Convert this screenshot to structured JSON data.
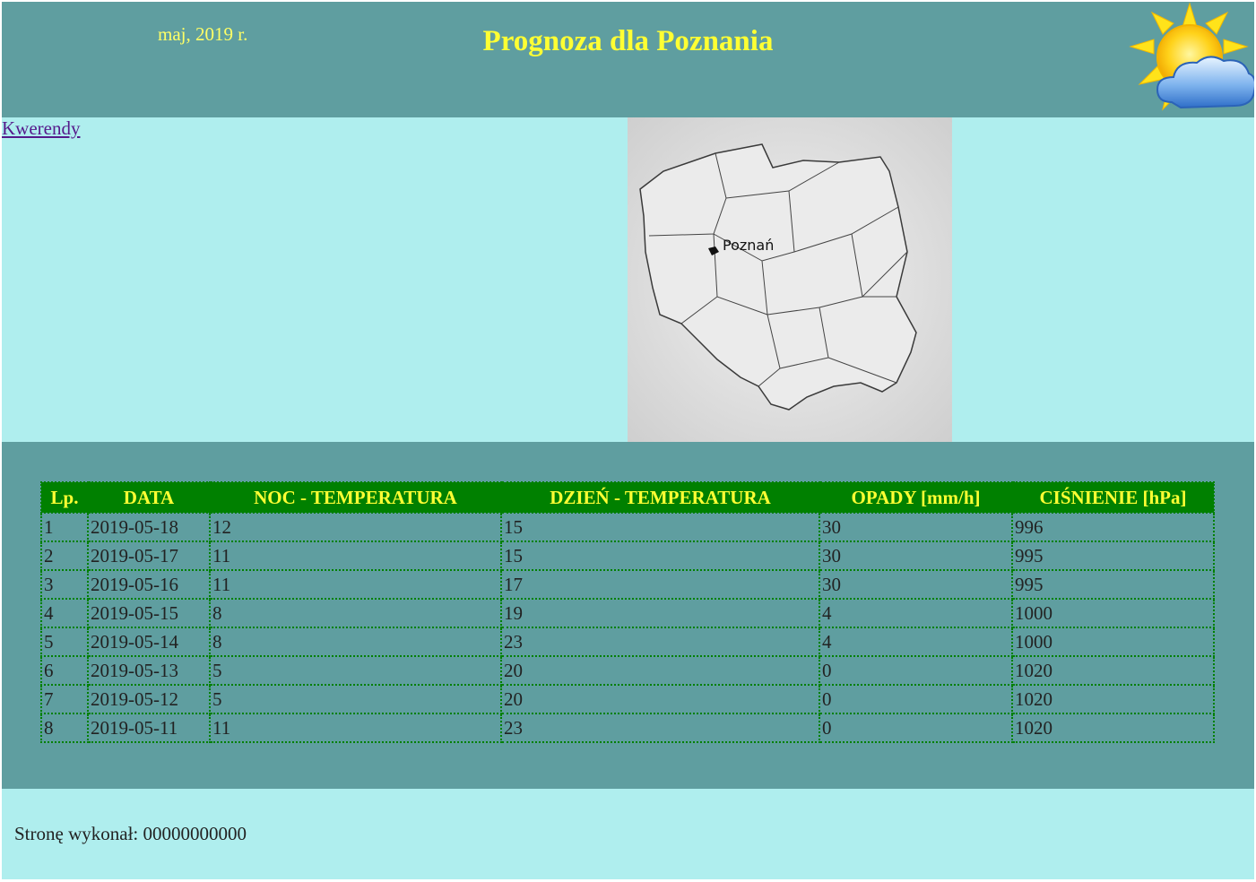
{
  "header": {
    "date": "maj, 2019 r.",
    "title": "Prognoza dla Poznania",
    "sun_icon": "sun-with-cloud-icon"
  },
  "left": {
    "link_label": "Kwerendy"
  },
  "right": {
    "map_label": "Poznań",
    "map_icon": "poland-map-image"
  },
  "table": {
    "headers": [
      "Lp.",
      "DATA",
      "NOC - TEMPERATURA",
      "DZIEŃ - TEMPERATURA",
      "OPADY [mm/h]",
      "CIŚNIENIE [hPa]"
    ],
    "rows": [
      [
        "1",
        "2019-05-18",
        "12",
        "15",
        "30",
        "996"
      ],
      [
        "2",
        "2019-05-17",
        "11",
        "15",
        "30",
        "995"
      ],
      [
        "3",
        "2019-05-16",
        "11",
        "17",
        "30",
        "995"
      ],
      [
        "4",
        "2019-05-15",
        "8",
        "19",
        "4",
        "1000"
      ],
      [
        "5",
        "2019-05-14",
        "8",
        "23",
        "4",
        "1000"
      ],
      [
        "6",
        "2019-05-13",
        "5",
        "20",
        "0",
        "1020"
      ],
      [
        "7",
        "2019-05-12",
        "5",
        "20",
        "0",
        "1020"
      ],
      [
        "8",
        "2019-05-11",
        "11",
        "23",
        "0",
        "1020"
      ]
    ]
  },
  "footer": {
    "text": "Stronę wykonał: 00000000000"
  },
  "colors": {
    "banner": "#5f9ea0",
    "panel": "#afeeee",
    "header_bg": "#008000",
    "header_text": "#ffff33"
  }
}
